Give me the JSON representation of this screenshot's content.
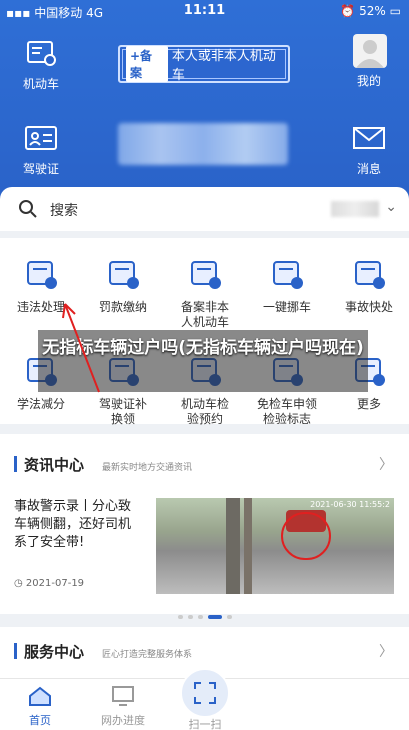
{
  "status_bar": {
    "carrier": "中国移动",
    "network": "4G",
    "time": "11:11",
    "battery": "52%"
  },
  "header": {
    "vehicle_label": "机动车",
    "license_label": "驾驶证",
    "plate_badge": "+备案",
    "plate_text": "本人或非本人机动车",
    "mine_label": "我的",
    "message_label": "消息"
  },
  "search": {
    "label": "搜索"
  },
  "services": [
    {
      "label": "违法处理",
      "icon": "car-violation-icon"
    },
    {
      "label": "罚款缴纳",
      "icon": "fine-payment-icon"
    },
    {
      "label": "备案非本\n人机动车",
      "icon": "record-vehicle-icon"
    },
    {
      "label": "一键挪车",
      "icon": "move-car-icon"
    },
    {
      "label": "事故快处",
      "icon": "accident-icon"
    },
    {
      "label": "学法减分",
      "icon": "study-icon"
    },
    {
      "label": "驾驶证补\n换领",
      "icon": "license-renew-icon"
    },
    {
      "label": "机动车检\n验预约",
      "icon": "inspection-icon"
    },
    {
      "label": "免检车申领\n检验标志",
      "icon": "exempt-icon"
    },
    {
      "label": "更多",
      "icon": "more-icon"
    }
  ],
  "overlay": {
    "title": "无指标车辆过户吗(无指标车辆过户吗现在)"
  },
  "news": {
    "title": "资讯中心",
    "subtitle": "最新实时地方交通资讯",
    "headline": "事故警示录丨分心致车辆侧翻，还好司机系了安全带!",
    "date": "2021-07-19",
    "image_timestamp": "2021-06-30 11:55:2"
  },
  "service_center": {
    "title": "服务中心",
    "subtitle": "匠心打造完整服务体系"
  },
  "tabbar": {
    "home": "首页",
    "progress": "网办进度",
    "scan": "扫一扫"
  },
  "colors": {
    "brand": "#2a62c8",
    "annotation": "#e02020"
  }
}
